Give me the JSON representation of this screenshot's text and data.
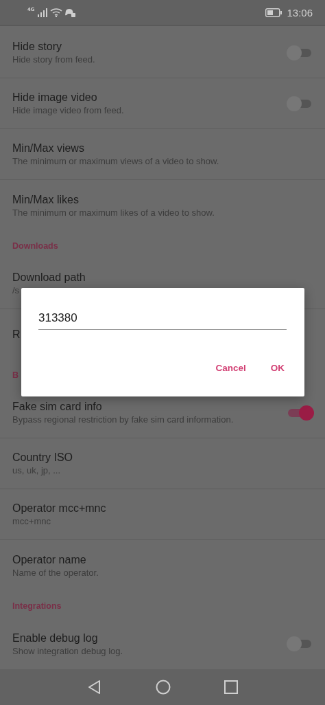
{
  "status_bar": {
    "network": "4G",
    "time": "13:06"
  },
  "settings": [
    {
      "kind": "toggle",
      "title": "Hide story",
      "subtitle": "Hide story from feed.",
      "on": false
    },
    {
      "kind": "toggle",
      "title": "Hide image video",
      "subtitle": "Hide image video from feed.",
      "on": false
    },
    {
      "kind": "item",
      "title": "Min/Max views",
      "subtitle": "The minimum or maximum views of a video to show."
    },
    {
      "kind": "item",
      "title": "Min/Max likes",
      "subtitle": "The minimum or maximum likes of a video to show."
    },
    {
      "kind": "header",
      "title": "Downloads"
    },
    {
      "kind": "item",
      "title": "Download path",
      "subtitle": "/s"
    },
    {
      "kind": "item",
      "title": "R"
    },
    {
      "kind": "header",
      "title": "B"
    },
    {
      "kind": "toggle",
      "title": "Fake sim card info",
      "subtitle": "Bypass regional restriction by fake sim card information.",
      "on": true
    },
    {
      "kind": "item",
      "title": "Country ISO",
      "subtitle": "us, uk, jp, ..."
    },
    {
      "kind": "item",
      "title": "Operator mcc+mnc",
      "subtitle": "mcc+mnc"
    },
    {
      "kind": "item",
      "title": "Operator name",
      "subtitle": "Name of the operator."
    },
    {
      "kind": "header",
      "title": "Integrations"
    },
    {
      "kind": "toggle",
      "title": "Enable debug log",
      "subtitle": "Show integration debug log.",
      "on": false
    }
  ],
  "dialog": {
    "value": "313380",
    "buttons": [
      "Cancel",
      "OK"
    ]
  }
}
